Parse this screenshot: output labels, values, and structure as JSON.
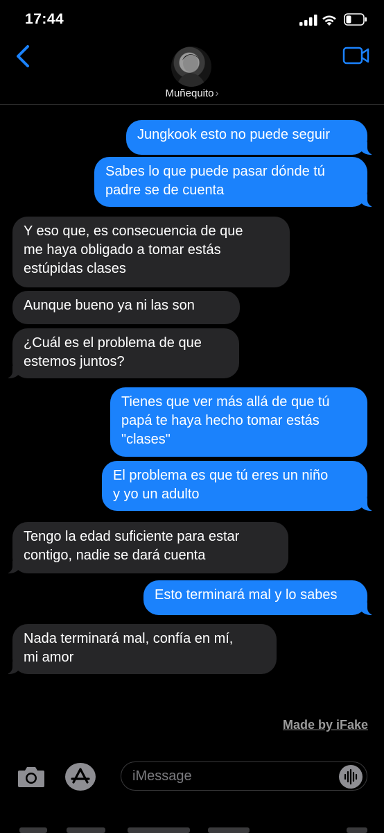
{
  "status_bar": {
    "time": "17:44",
    "icons": [
      "cellular-signal-icon",
      "wifi-icon",
      "battery-low-icon"
    ]
  },
  "header": {
    "back_icon": "chevron-left-icon",
    "contact_name": "Muñequito",
    "contact_chevron": "›",
    "video_icon": "video-camera-icon",
    "accent_color": "#1b82fc"
  },
  "messages": [
    {
      "direction": "outgoing",
      "text": "Jungkook esto no puede seguir"
    },
    {
      "direction": "outgoing",
      "text": "Sabes lo que puede pasar dónde tú\npadre se de cuenta"
    },
    {
      "direction": "incoming",
      "text": "Y eso que, es consecuencia de que\nme haya obligado a tomar estás\nestúpidas clases"
    },
    {
      "direction": "incoming",
      "text": "Aunque bueno ya ni las son"
    },
    {
      "direction": "incoming",
      "text": "¿Cuál es el problema de que\nestemos juntos?"
    },
    {
      "direction": "outgoing",
      "text": "Tienes que ver más allá de que tú\npapá te haya hecho tomar estás\n\"clases\""
    },
    {
      "direction": "outgoing",
      "text": "El problema es que tú eres un niño\ny yo un adulto"
    },
    {
      "direction": "incoming",
      "text": "Tengo la edad suficiente para estar\ncontigo, nadie se dará cuenta"
    },
    {
      "direction": "outgoing",
      "text": "Esto terminará mal y lo sabes"
    },
    {
      "direction": "incoming",
      "text": "Nada terminará mal, confía en mí,\nmi amor"
    }
  ],
  "watermark": "Made by iFake",
  "composer": {
    "placeholder": "iMessage",
    "camera_icon": "camera-icon",
    "apps_icon": "app-store-icon",
    "audio_icon": "audio-waveform-icon"
  },
  "colors": {
    "outgoing_bubble": "#1b82fc",
    "incoming_bubble": "#262628",
    "background": "#000000"
  }
}
